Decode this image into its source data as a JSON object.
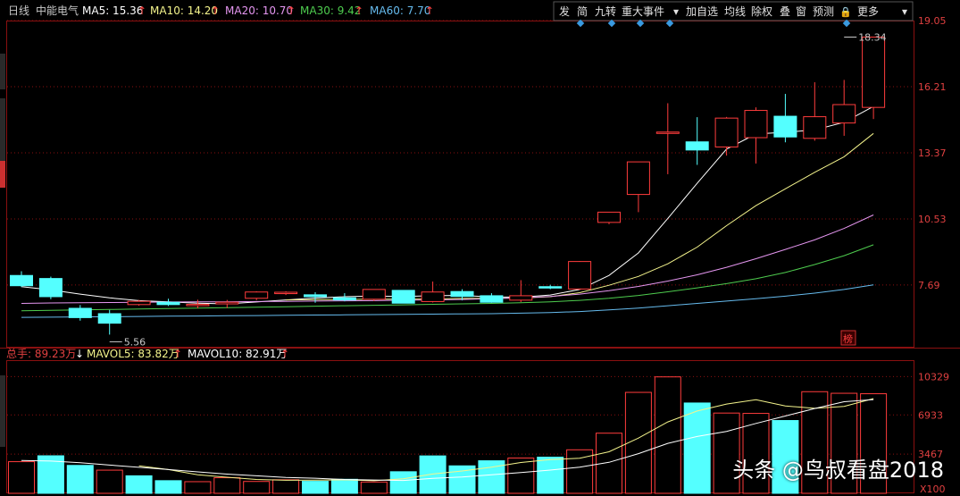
{
  "header": {
    "period": "日线",
    "stock": "中能电气",
    "ma": [
      {
        "label": "MA5: 15.36",
        "color": "#ffffff"
      },
      {
        "label": "MA10: 14.20",
        "color": "#f4f48c"
      },
      {
        "label": "MA20: 10.70",
        "color": "#e596f0"
      },
      {
        "label": "MA30: 9.42",
        "color": "#4ecc4e"
      },
      {
        "label": "MA60: 7.70",
        "color": "#66bbee"
      }
    ]
  },
  "toolbar": [
    "发",
    "简",
    "九转",
    "重大事件",
    "▾",
    "加自选",
    "均线",
    "除权",
    "叠",
    "窗",
    "预测",
    "🔒",
    "更多",
    "▾"
  ],
  "volume_header": {
    "total": "总手: 89.23万",
    "mavol5": "MAVOL5: 83.82万",
    "mavol10": "MAVOL10: 82.91万"
  },
  "badge": "榜",
  "unit": "X100",
  "watermark": "头条 @鸟叔看盘2018",
  "chart_data": [
    {
      "type": "candlestick",
      "title": "中能电气 日线",
      "y_ticks": [
        7.69,
        10.53,
        13.37,
        16.21,
        19.05
      ],
      "ylim": [
        5.0,
        19.05
      ],
      "annotations": [
        {
          "label": "5.56",
          "index": 3
        },
        {
          "label": "18.34",
          "index": 28
        }
      ],
      "candles": [
        {
          "o": 8.1,
          "c": 7.66,
          "h": 8.28,
          "l": 7.6
        },
        {
          "o": 7.97,
          "c": 7.19,
          "h": 8.05,
          "l": 7.08
        },
        {
          "o": 6.69,
          "c": 6.29,
          "h": 6.83,
          "l": 6.16
        },
        {
          "o": 6.46,
          "c": 6.05,
          "h": 6.62,
          "l": 5.56
        },
        {
          "o": 6.85,
          "c": 6.99,
          "h": 7.05,
          "l": 6.8
        },
        {
          "o": 6.95,
          "c": 6.85,
          "h": 7.1,
          "l": 6.79
        },
        {
          "o": 6.82,
          "c": 6.86,
          "h": 7.06,
          "l": 6.69
        },
        {
          "o": 6.88,
          "c": 6.95,
          "h": 7.05,
          "l": 6.7
        },
        {
          "o": 7.12,
          "c": 7.39,
          "h": 7.42,
          "l": 7.04
        },
        {
          "o": 7.32,
          "c": 7.38,
          "h": 7.42,
          "l": 7.26
        },
        {
          "o": 7.27,
          "c": 7.19,
          "h": 7.38,
          "l": 6.93
        },
        {
          "o": 7.14,
          "c": 7.05,
          "h": 7.34,
          "l": 6.99
        },
        {
          "o": 7.08,
          "c": 7.5,
          "h": 7.51,
          "l": 7.0
        },
        {
          "o": 7.46,
          "c": 6.91,
          "h": 7.47,
          "l": 6.9
        },
        {
          "o": 6.98,
          "c": 7.39,
          "h": 7.84,
          "l": 6.94
        },
        {
          "o": 7.41,
          "c": 7.2,
          "h": 7.51,
          "l": 7.03
        },
        {
          "o": 7.23,
          "c": 6.95,
          "h": 7.34,
          "l": 6.93
        },
        {
          "o": 7.04,
          "c": 7.23,
          "h": 7.9,
          "l": 6.96
        },
        {
          "o": 7.62,
          "c": 7.56,
          "h": 7.7,
          "l": 7.51
        },
        {
          "o": 7.52,
          "c": 8.7,
          "h": 8.72,
          "l": 7.48
        },
        {
          "o": 10.38,
          "c": 10.82,
          "h": 10.82,
          "l": 10.3
        },
        {
          "o": 11.58,
          "c": 12.98,
          "h": 12.98,
          "l": 10.82
        },
        {
          "o": 14.26,
          "c": 14.26,
          "h": 15.5,
          "l": 12.45
        },
        {
          "o": 13.84,
          "c": 13.49,
          "h": 14.9,
          "l": 12.85
        },
        {
          "o": 13.62,
          "c": 14.86,
          "h": 14.91,
          "l": 13.25
        },
        {
          "o": 14.02,
          "c": 15.19,
          "h": 15.32,
          "l": 12.91
        },
        {
          "o": 14.94,
          "c": 14.05,
          "h": 15.9,
          "l": 13.82
        },
        {
          "o": 13.99,
          "c": 14.92,
          "h": 16.4,
          "l": 13.89
        },
        {
          "o": 14.65,
          "c": 15.44,
          "h": 16.5,
          "l": 14.1
        },
        {
          "o": 15.32,
          "c": 18.34,
          "h": 18.34,
          "l": 14.82
        }
      ],
      "series": [
        {
          "name": "MA5",
          "color": "#ffffff",
          "values": [
            7.62,
            7.48,
            7.3,
            7.14,
            7.02,
            6.97,
            6.91,
            6.88,
            6.96,
            7.05,
            7.13,
            7.19,
            7.22,
            7.2,
            7.23,
            7.24,
            7.18,
            7.17,
            7.26,
            7.5,
            8.1,
            9.07,
            10.55,
            12.06,
            13.53,
            14.18,
            14.25,
            14.35,
            14.68,
            15.36
          ]
        },
        {
          "name": "MA10",
          "color": "#f4f48c",
          "values": [
            null,
            null,
            null,
            null,
            null,
            null,
            null,
            null,
            null,
            7.05,
            7.06,
            7.07,
            7.08,
            7.08,
            7.09,
            7.11,
            7.12,
            7.13,
            7.19,
            7.36,
            7.68,
            8.06,
            8.6,
            9.32,
            10.24,
            11.1,
            11.82,
            12.53,
            13.2,
            14.2
          ]
        },
        {
          "name": "MA20",
          "color": "#e596f0",
          "values": [
            6.9,
            6.92,
            6.93,
            6.94,
            6.95,
            6.96,
            6.97,
            6.97,
            6.98,
            6.99,
            7.0,
            7.01,
            7.02,
            7.04,
            7.05,
            7.07,
            7.1,
            7.14,
            7.2,
            7.3,
            7.45,
            7.63,
            7.86,
            8.13,
            8.45,
            8.82,
            9.22,
            9.63,
            10.12,
            10.7
          ]
        },
        {
          "name": "MA30",
          "color": "#4ecc4e",
          "values": [
            6.58,
            6.6,
            6.62,
            6.64,
            6.66,
            6.68,
            6.7,
            6.72,
            6.74,
            6.76,
            6.78,
            6.8,
            6.82,
            6.84,
            6.86,
            6.88,
            6.9,
            6.93,
            6.97,
            7.03,
            7.12,
            7.24,
            7.4,
            7.57,
            7.75,
            7.96,
            8.23,
            8.57,
            8.95,
            9.42
          ]
        },
        {
          "name": "MA60",
          "color": "#66bbee",
          "values": [
            6.3,
            6.31,
            6.32,
            6.33,
            6.34,
            6.35,
            6.36,
            6.37,
            6.38,
            6.39,
            6.4,
            6.41,
            6.42,
            6.43,
            6.44,
            6.45,
            6.46,
            6.48,
            6.51,
            6.55,
            6.62,
            6.7,
            6.8,
            6.9,
            7.0,
            7.1,
            7.21,
            7.34,
            7.5,
            7.7
          ]
        }
      ]
    },
    {
      "type": "bar",
      "title": "成交量",
      "y_ticks": [
        3467,
        6933,
        10329
      ],
      "ylim": [
        0,
        11700
      ],
      "values": [
        2800,
        3320,
        2470,
        2050,
        1550,
        1120,
        1030,
        1380,
        1050,
        1200,
        1060,
        1240,
        1000,
        1910,
        3310,
        2430,
        2880,
        3120,
        3200,
        3850,
        5320,
        8930,
        10300,
        7990,
        7100,
        7070,
        6440,
        8990,
        8850,
        8810
      ],
      "up": [
        true,
        false,
        false,
        true,
        false,
        false,
        true,
        true,
        true,
        true,
        false,
        false,
        true,
        false,
        false,
        false,
        false,
        true,
        false,
        true,
        true,
        true,
        true,
        false,
        true,
        true,
        false,
        true,
        true,
        true
      ],
      "series": [
        {
          "name": "MAVOL5",
          "color": "#f4f48c",
          "values": [
            null,
            null,
            null,
            null,
            2438,
            2102,
            1644,
            1426,
            1226,
            1156,
            1164,
            1192,
            1111,
            1282,
            1704,
            1978,
            2306,
            2730,
            2988,
            3096,
            3674,
            4884,
            6320,
            7278,
            7898,
            8278,
            7720,
            7518,
            7690,
            8382
          ]
        },
        {
          "name": "MAVOL10",
          "color": "#ffffff",
          "values": [
            2900,
            2850,
            2700,
            2500,
            2300,
            2100,
            1900,
            1700,
            1550,
            1410,
            1336,
            1224,
            1177,
            1142,
            1317,
            1448,
            1633,
            1838,
            2053,
            2318,
            2746,
            3508,
            4418,
            5026,
            5476,
            6182,
            6840,
            7500,
            8100,
            8291
          ]
        }
      ]
    }
  ]
}
